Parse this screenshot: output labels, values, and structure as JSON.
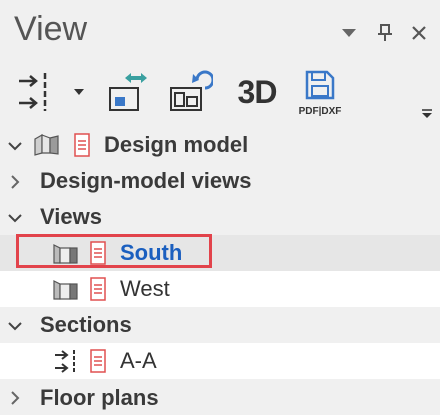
{
  "panel": {
    "title": "View"
  },
  "toolbar": {
    "btn_3d": "3D",
    "pdf_dxf": "PDF|DXF"
  },
  "tree": {
    "design_model": "Design model",
    "design_model_views": "Design-model views",
    "views": "Views",
    "south": "South",
    "west": "West",
    "sections": "Sections",
    "aa": "A-A",
    "floor_plans": "Floor plans"
  },
  "colors": {
    "selection_text": "#1b5fbf",
    "highlight_border": "#e2434b",
    "doc_icon": "#e05050"
  }
}
